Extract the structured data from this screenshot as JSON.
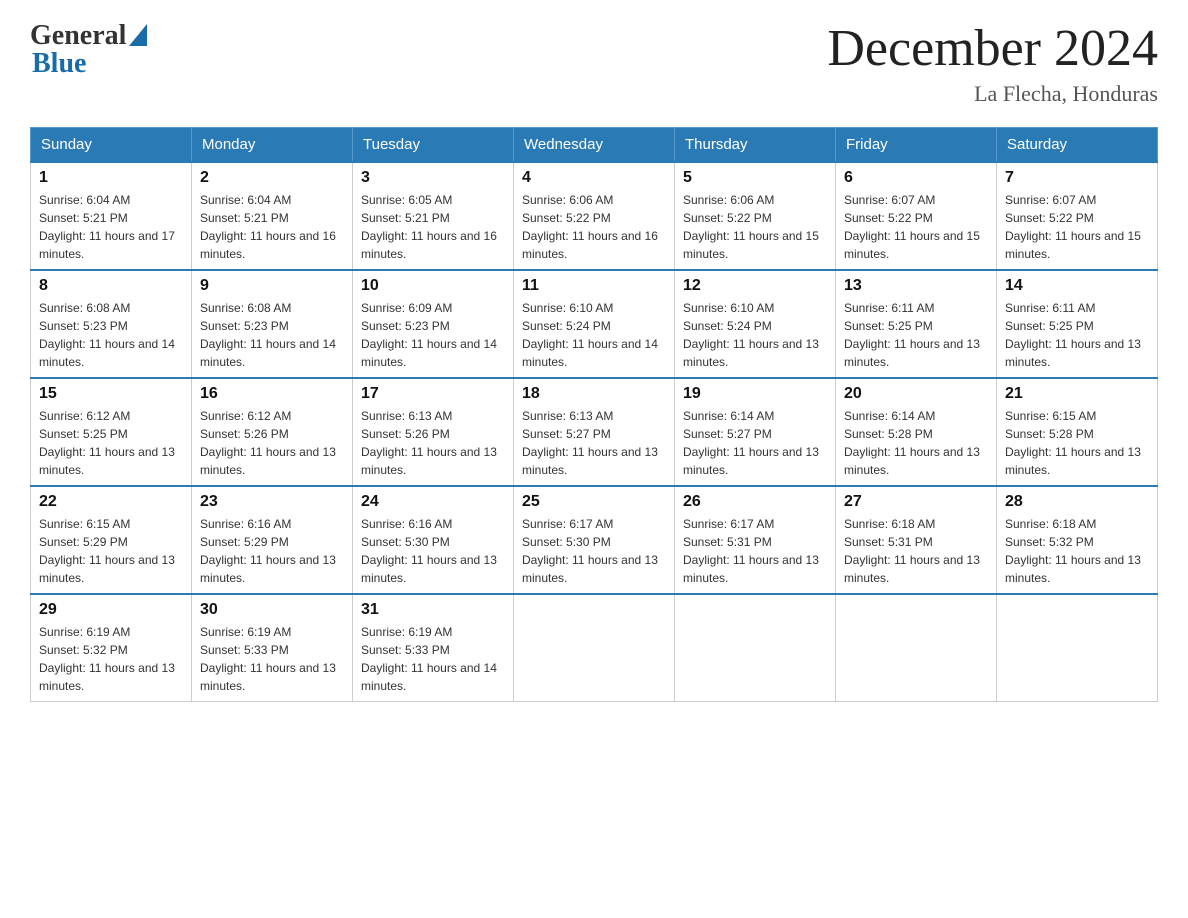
{
  "header": {
    "logo_general": "General",
    "logo_blue": "Blue",
    "month_title": "December 2024",
    "location": "La Flecha, Honduras"
  },
  "days_of_week": [
    "Sunday",
    "Monday",
    "Tuesday",
    "Wednesday",
    "Thursday",
    "Friday",
    "Saturday"
  ],
  "weeks": [
    [
      {
        "day": "1",
        "sunrise": "6:04 AM",
        "sunset": "5:21 PM",
        "daylight": "11 hours and 17 minutes."
      },
      {
        "day": "2",
        "sunrise": "6:04 AM",
        "sunset": "5:21 PM",
        "daylight": "11 hours and 16 minutes."
      },
      {
        "day": "3",
        "sunrise": "6:05 AM",
        "sunset": "5:21 PM",
        "daylight": "11 hours and 16 minutes."
      },
      {
        "day": "4",
        "sunrise": "6:06 AM",
        "sunset": "5:22 PM",
        "daylight": "11 hours and 16 minutes."
      },
      {
        "day": "5",
        "sunrise": "6:06 AM",
        "sunset": "5:22 PM",
        "daylight": "11 hours and 15 minutes."
      },
      {
        "day": "6",
        "sunrise": "6:07 AM",
        "sunset": "5:22 PM",
        "daylight": "11 hours and 15 minutes."
      },
      {
        "day": "7",
        "sunrise": "6:07 AM",
        "sunset": "5:22 PM",
        "daylight": "11 hours and 15 minutes."
      }
    ],
    [
      {
        "day": "8",
        "sunrise": "6:08 AM",
        "sunset": "5:23 PM",
        "daylight": "11 hours and 14 minutes."
      },
      {
        "day": "9",
        "sunrise": "6:08 AM",
        "sunset": "5:23 PM",
        "daylight": "11 hours and 14 minutes."
      },
      {
        "day": "10",
        "sunrise": "6:09 AM",
        "sunset": "5:23 PM",
        "daylight": "11 hours and 14 minutes."
      },
      {
        "day": "11",
        "sunrise": "6:10 AM",
        "sunset": "5:24 PM",
        "daylight": "11 hours and 14 minutes."
      },
      {
        "day": "12",
        "sunrise": "6:10 AM",
        "sunset": "5:24 PM",
        "daylight": "11 hours and 13 minutes."
      },
      {
        "day": "13",
        "sunrise": "6:11 AM",
        "sunset": "5:25 PM",
        "daylight": "11 hours and 13 minutes."
      },
      {
        "day": "14",
        "sunrise": "6:11 AM",
        "sunset": "5:25 PM",
        "daylight": "11 hours and 13 minutes."
      }
    ],
    [
      {
        "day": "15",
        "sunrise": "6:12 AM",
        "sunset": "5:25 PM",
        "daylight": "11 hours and 13 minutes."
      },
      {
        "day": "16",
        "sunrise": "6:12 AM",
        "sunset": "5:26 PM",
        "daylight": "11 hours and 13 minutes."
      },
      {
        "day": "17",
        "sunrise": "6:13 AM",
        "sunset": "5:26 PM",
        "daylight": "11 hours and 13 minutes."
      },
      {
        "day": "18",
        "sunrise": "6:13 AM",
        "sunset": "5:27 PM",
        "daylight": "11 hours and 13 minutes."
      },
      {
        "day": "19",
        "sunrise": "6:14 AM",
        "sunset": "5:27 PM",
        "daylight": "11 hours and 13 minutes."
      },
      {
        "day": "20",
        "sunrise": "6:14 AM",
        "sunset": "5:28 PM",
        "daylight": "11 hours and 13 minutes."
      },
      {
        "day": "21",
        "sunrise": "6:15 AM",
        "sunset": "5:28 PM",
        "daylight": "11 hours and 13 minutes."
      }
    ],
    [
      {
        "day": "22",
        "sunrise": "6:15 AM",
        "sunset": "5:29 PM",
        "daylight": "11 hours and 13 minutes."
      },
      {
        "day": "23",
        "sunrise": "6:16 AM",
        "sunset": "5:29 PM",
        "daylight": "11 hours and 13 minutes."
      },
      {
        "day": "24",
        "sunrise": "6:16 AM",
        "sunset": "5:30 PM",
        "daylight": "11 hours and 13 minutes."
      },
      {
        "day": "25",
        "sunrise": "6:17 AM",
        "sunset": "5:30 PM",
        "daylight": "11 hours and 13 minutes."
      },
      {
        "day": "26",
        "sunrise": "6:17 AM",
        "sunset": "5:31 PM",
        "daylight": "11 hours and 13 minutes."
      },
      {
        "day": "27",
        "sunrise": "6:18 AM",
        "sunset": "5:31 PM",
        "daylight": "11 hours and 13 minutes."
      },
      {
        "day": "28",
        "sunrise": "6:18 AM",
        "sunset": "5:32 PM",
        "daylight": "11 hours and 13 minutes."
      }
    ],
    [
      {
        "day": "29",
        "sunrise": "6:19 AM",
        "sunset": "5:32 PM",
        "daylight": "11 hours and 13 minutes."
      },
      {
        "day": "30",
        "sunrise": "6:19 AM",
        "sunset": "5:33 PM",
        "daylight": "11 hours and 13 minutes."
      },
      {
        "day": "31",
        "sunrise": "6:19 AM",
        "sunset": "5:33 PM",
        "daylight": "11 hours and 14 minutes."
      },
      null,
      null,
      null,
      null
    ]
  ]
}
